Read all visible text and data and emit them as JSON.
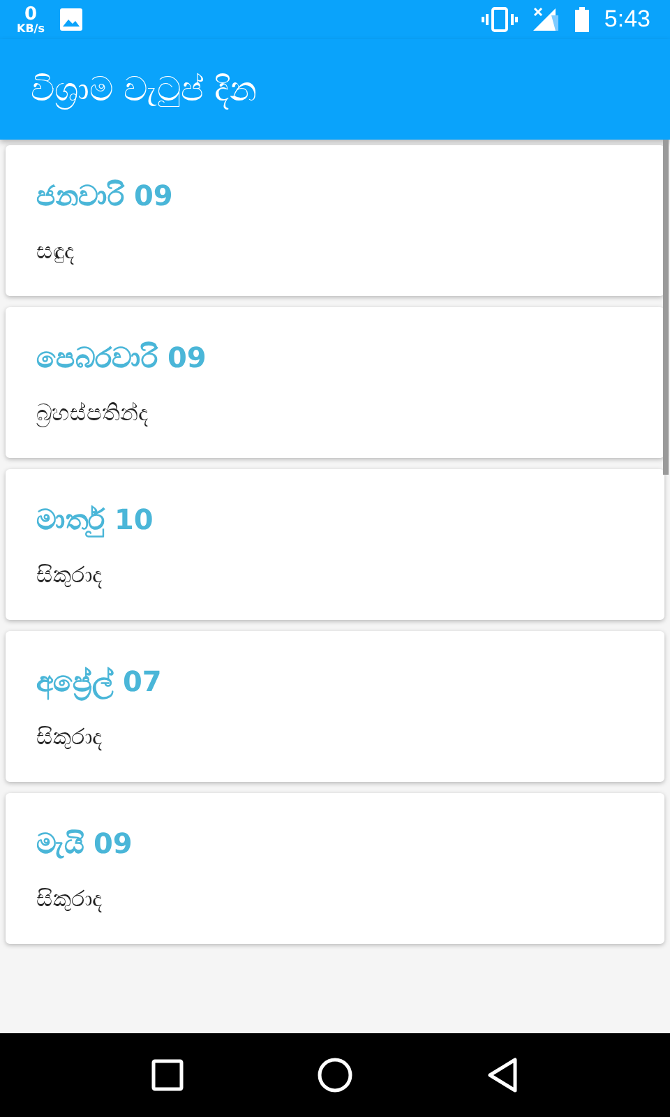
{
  "status_bar": {
    "speed": "0",
    "speed_unit": "KB/s",
    "time": "5:43"
  },
  "app_bar": {
    "title": "විශ්‍රාම වැටුප් දින"
  },
  "holidays": [
    {
      "date": "ජනවාරි 09",
      "weekday": "සඳුද"
    },
    {
      "date": "පෙබරවාරි 09",
      "weekday": "බ්‍රහස්පතින්ද"
    },
    {
      "date": "මාර්තු 10",
      "weekday": "සිකුරාද"
    },
    {
      "date": "අප්‍රේල් 07",
      "weekday": "සිකුරාද"
    },
    {
      "date": "මැයි 09",
      "weekday": "සිකුරාද"
    }
  ]
}
